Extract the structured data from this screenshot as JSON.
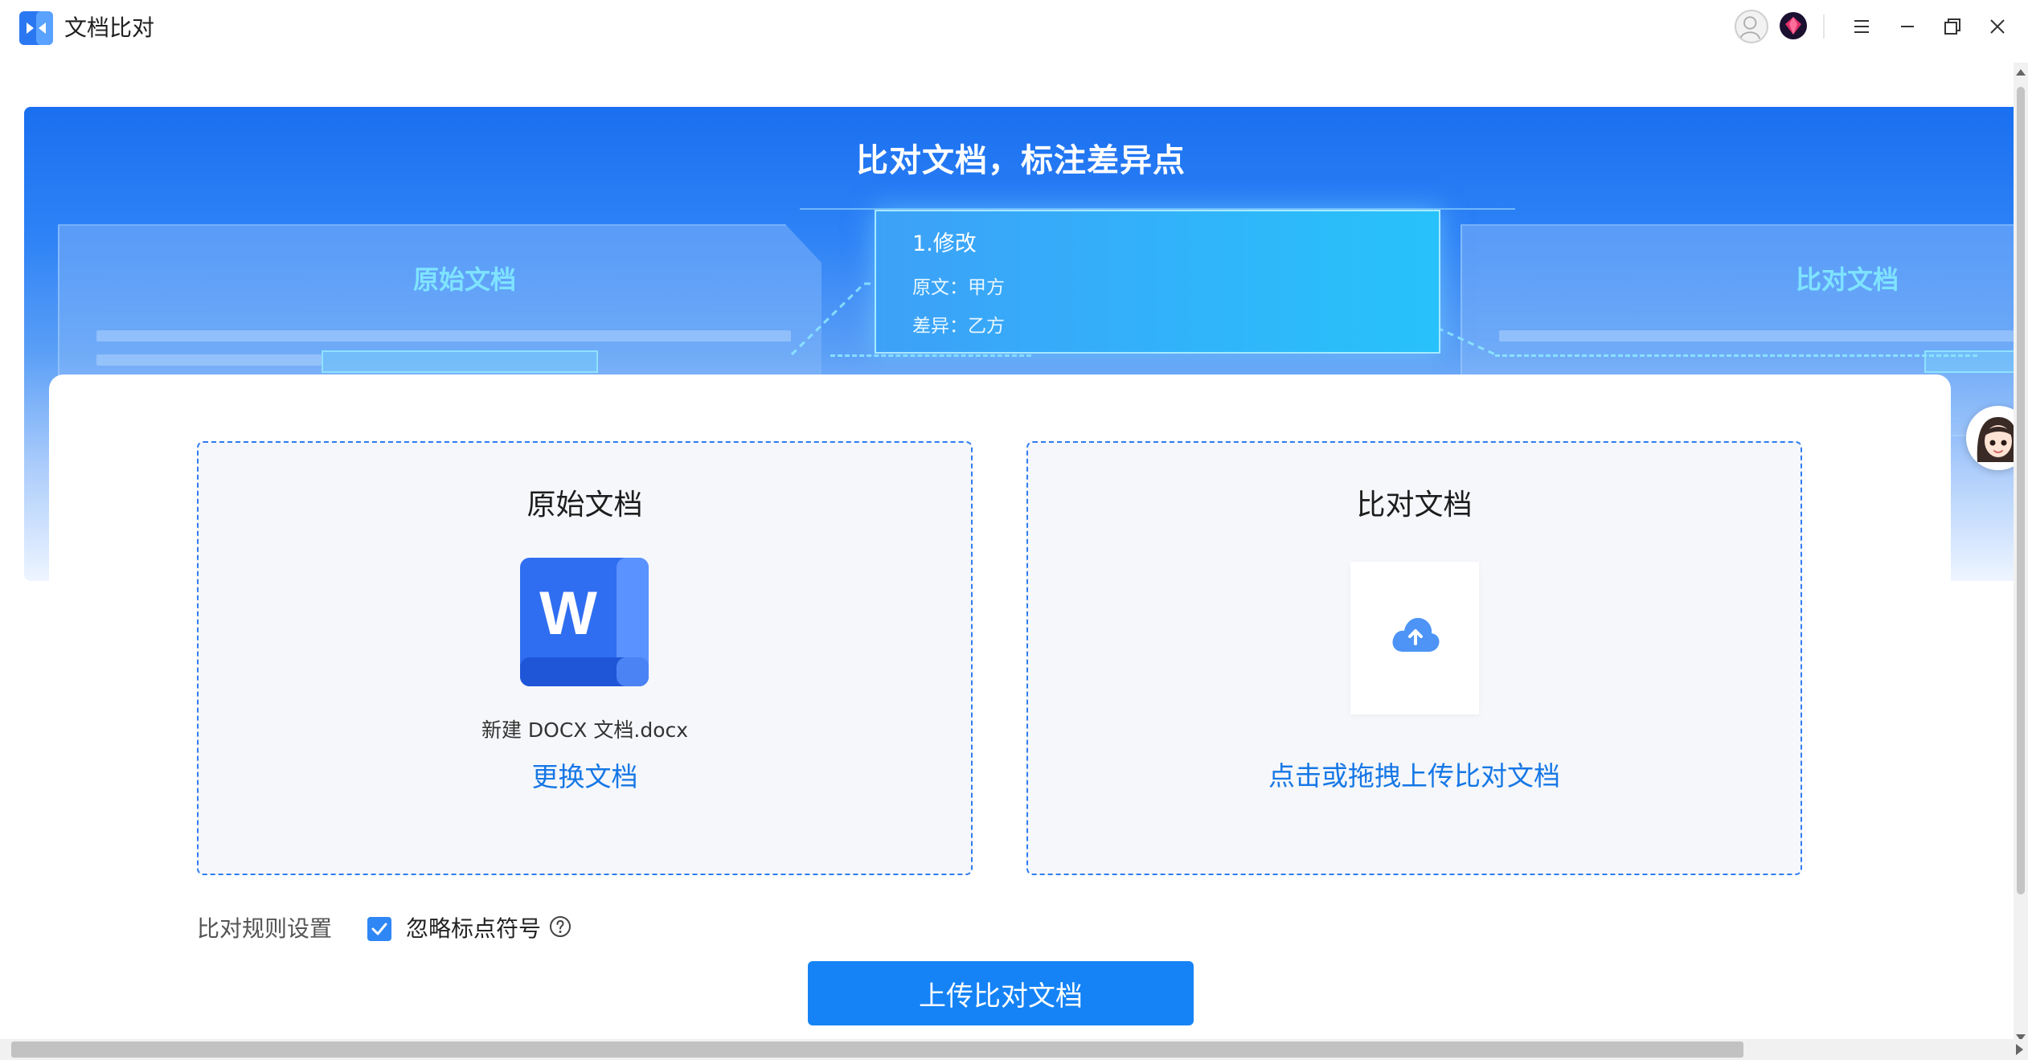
{
  "window": {
    "title": "文档比对",
    "controls": [
      "menu-icon",
      "minimize-icon",
      "restore-icon",
      "close-icon"
    ]
  },
  "banner": {
    "title": "比对文档，标注差异点",
    "left_panel_label": "原始文档",
    "right_panel_label": "比对文档",
    "popup": {
      "title": "1.修改",
      "original": "原文：甲方",
      "difference": "差异：乙方"
    }
  },
  "main": {
    "original_doc": {
      "title": "原始文档",
      "file_name": "新建 DOCX 文档.docx",
      "replace_link": "更换文档",
      "file_icon_letter": "W"
    },
    "compare_doc": {
      "title": "比对文档",
      "upload_link": "点击或拖拽上传比对文档",
      "icon": "cloud-upload-icon"
    },
    "rules": {
      "label": "比对规则设置",
      "ignore_punctuation_label": "忽略标点符号",
      "ignore_punctuation_checked": true
    },
    "upload_button": "上传比对文档"
  },
  "colors": {
    "accent": "#1583f5",
    "link": "#1677e6",
    "banner_top": "#1a6ff0",
    "popup": "#27c2fb",
    "panel_label": "#7fe3ff"
  }
}
